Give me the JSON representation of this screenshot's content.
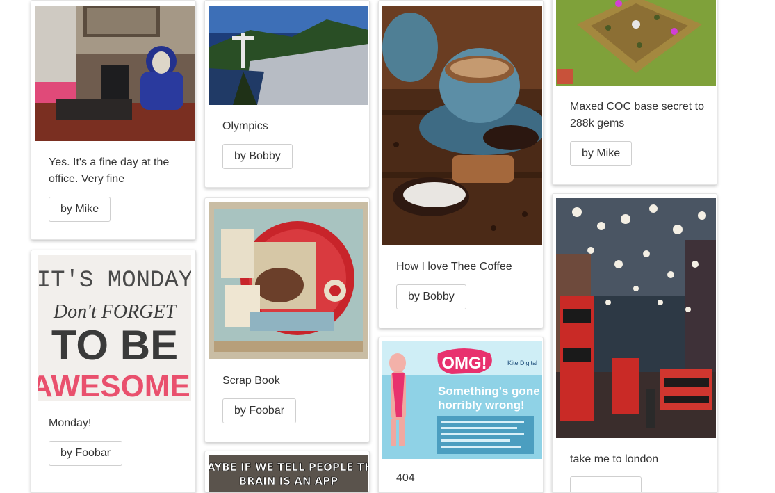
{
  "pins": [
    {
      "caption": "Yes. It's a fine day at the office. Very fine",
      "author": "by Mike"
    },
    {
      "caption": "Monday!",
      "author": "by Foobar",
      "image_text": {
        "line1": "IT'S MONDAY",
        "line2": "Don't FORGET",
        "line3": "TO BE",
        "line4": "AWESOME."
      }
    },
    {
      "caption": "Olympics",
      "author": "by Bobby"
    },
    {
      "caption": "Scrap Book",
      "author": "by Foobar"
    },
    {
      "caption": "",
      "author": "",
      "image_text": {
        "line1": "MAYBE IF WE TELL PEOPLE THE",
        "line2": "BRAIN IS AN APP"
      }
    },
    {
      "caption": "How I love Thee Coffee",
      "author": "by Bobby"
    },
    {
      "caption": "404",
      "author": "",
      "image_text": {
        "badge": "OMG!",
        "brand": "Kite Digital",
        "line1": "Something's gone",
        "line2": "horribly wrong!"
      }
    },
    {
      "caption": "Maxed COC base secret to 288k gems",
      "author": "by Mike"
    },
    {
      "caption": "take me to london",
      "author": ""
    }
  ],
  "colors": {
    "card_border": "#e4e4e4",
    "button_border": "#cfcfcf",
    "text": "#333333"
  }
}
